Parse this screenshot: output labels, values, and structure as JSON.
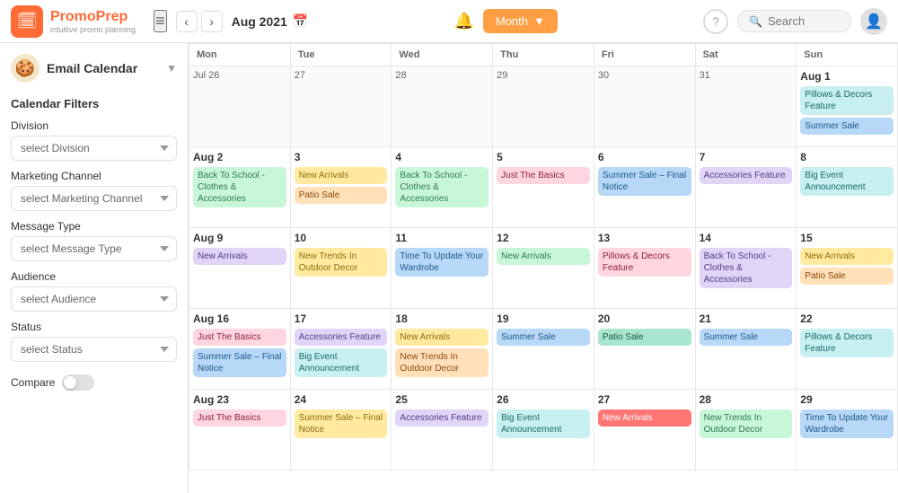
{
  "header": {
    "logo_title": "PromoPrep",
    "logo_sub": "intuitive promo planning",
    "current_month": "Aug 2021",
    "month_btn": "Month",
    "search_placeholder": "Search",
    "help_icon": "?",
    "bell_icon": "🔔"
  },
  "sidebar": {
    "email_calendar": "Email Calendar",
    "filter_heading": "Calendar Filters",
    "division_label": "Division",
    "division_placeholder": "select Division",
    "marketing_label": "Marketing Channel",
    "marketing_placeholder": "select Marketing Channel",
    "message_label": "Message Type",
    "message_placeholder": "select Message Type",
    "audience_label": "Audience",
    "audience_placeholder": "select Audience",
    "status_label": "Status",
    "status_placeholder": "select Status",
    "compare_label": "Compare"
  },
  "calendar": {
    "day_headers": [
      "Mon",
      "Tue",
      "Wed",
      "Thu",
      "Fri",
      "Sat",
      "Sun"
    ],
    "weeks": [
      {
        "days": [
          {
            "num": "Jul 26",
            "other": true,
            "events": []
          },
          {
            "num": "27",
            "other": true,
            "events": []
          },
          {
            "num": "28",
            "other": true,
            "events": []
          },
          {
            "num": "29",
            "other": true,
            "events": []
          },
          {
            "num": "30",
            "other": true,
            "events": []
          },
          {
            "num": "31",
            "other": true,
            "events": []
          },
          {
            "num": "Aug 1",
            "other": false,
            "events": [
              {
                "text": "Pillows & Decors Feature",
                "color": "teal"
              },
              {
                "text": "Summer Sale",
                "color": "blue"
              }
            ]
          }
        ]
      },
      {
        "days": [
          {
            "num": "Aug 2",
            "other": false,
            "events": [
              {
                "text": "Back To School - Clothes & Accessories",
                "color": "green"
              }
            ]
          },
          {
            "num": "3",
            "other": false,
            "events": [
              {
                "text": "New Arrivals",
                "color": "yellow"
              },
              {
                "text": "Patio Sale",
                "color": "orange"
              }
            ]
          },
          {
            "num": "4",
            "other": false,
            "events": [
              {
                "text": "Back To School - Clothes & Accessories",
                "color": "green"
              }
            ]
          },
          {
            "num": "5",
            "other": false,
            "events": [
              {
                "text": "Just The Basics",
                "color": "pink"
              }
            ]
          },
          {
            "num": "6",
            "other": false,
            "events": [
              {
                "text": "Summer Sale – Final Notice",
                "color": "blue"
              }
            ]
          },
          {
            "num": "7",
            "other": false,
            "events": [
              {
                "text": "Accessories Feature",
                "color": "purple"
              }
            ]
          },
          {
            "num": "8",
            "other": false,
            "events": [
              {
                "text": "Big Event Announcement",
                "color": "teal"
              }
            ]
          }
        ]
      },
      {
        "days": [
          {
            "num": "Aug 9",
            "other": false,
            "events": [
              {
                "text": "New Arrivals",
                "color": "purple"
              }
            ]
          },
          {
            "num": "10",
            "other": false,
            "events": [
              {
                "text": "New Trends In Outdoor Decor",
                "color": "yellow"
              }
            ]
          },
          {
            "num": "11",
            "other": false,
            "events": [
              {
                "text": "Time To Update Your Wardrobe",
                "color": "blue"
              }
            ]
          },
          {
            "num": "12",
            "other": false,
            "events": [
              {
                "text": "New Arrivals",
                "color": "green"
              }
            ]
          },
          {
            "num": "13",
            "other": false,
            "events": [
              {
                "text": "Pillows & Decors Feature",
                "color": "pink"
              }
            ]
          },
          {
            "num": "14",
            "other": false,
            "events": [
              {
                "text": "Back To School - Clothes & Accessories",
                "color": "purple"
              }
            ]
          },
          {
            "num": "15",
            "other": false,
            "events": [
              {
                "text": "New Arrivals",
                "color": "yellow"
              },
              {
                "text": "Patio Sale",
                "color": "orange"
              }
            ]
          }
        ]
      },
      {
        "days": [
          {
            "num": "Aug 16",
            "other": false,
            "events": [
              {
                "text": "Just The Basics",
                "color": "pink"
              },
              {
                "text": "Summer Sale – Final Notice",
                "color": "blue"
              }
            ]
          },
          {
            "num": "17",
            "other": false,
            "events": [
              {
                "text": "Accessories Feature",
                "color": "purple"
              },
              {
                "text": "Big Event Announcement",
                "color": "teal"
              }
            ]
          },
          {
            "num": "18",
            "other": false,
            "events": [
              {
                "text": "New Arrivals",
                "color": "yellow"
              },
              {
                "text": "New Trends In Outdoor Decor",
                "color": "orange"
              }
            ]
          },
          {
            "num": "19",
            "other": false,
            "events": [
              {
                "text": "Summer Sale",
                "color": "blue"
              }
            ]
          },
          {
            "num": "20",
            "other": false,
            "events": [
              {
                "text": "Patio Sale",
                "color": "mint"
              }
            ]
          },
          {
            "num": "21",
            "other": false,
            "events": [
              {
                "text": "Summer Sale",
                "color": "blue"
              }
            ]
          },
          {
            "num": "22",
            "other": false,
            "events": [
              {
                "text": "Pillows & Decors Feature",
                "color": "teal"
              }
            ]
          }
        ]
      },
      {
        "days": [
          {
            "num": "Aug 23",
            "other": false,
            "events": [
              {
                "text": "Just The Basics",
                "color": "pink"
              }
            ]
          },
          {
            "num": "24",
            "other": false,
            "events": [
              {
                "text": "Summer Sale – Final Notice",
                "color": "yellow"
              }
            ]
          },
          {
            "num": "25",
            "other": false,
            "events": [
              {
                "text": "Accessories Feature",
                "color": "purple"
              }
            ]
          },
          {
            "num": "26",
            "other": false,
            "events": [
              {
                "text": "Big Event Announcement",
                "color": "teal"
              }
            ]
          },
          {
            "num": "27",
            "other": false,
            "events": [
              {
                "text": "New Arrivals",
                "color": "red"
              }
            ]
          },
          {
            "num": "28",
            "other": false,
            "events": [
              {
                "text": "New Trends In Outdoor Decor",
                "color": "green"
              }
            ]
          },
          {
            "num": "29",
            "other": false,
            "events": [
              {
                "text": "Time To Update Your Wardrobe",
                "color": "blue"
              }
            ]
          }
        ]
      }
    ]
  }
}
